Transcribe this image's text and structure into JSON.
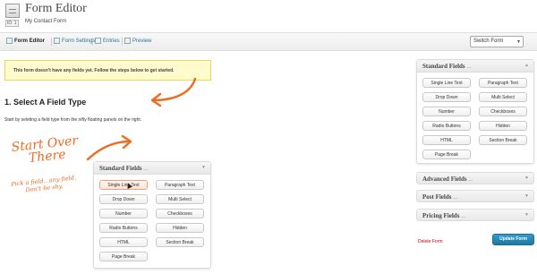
{
  "header": {
    "title": "Form Editor",
    "id_badge": "ID: 1",
    "form_name": "My Contact Form"
  },
  "toolbar": {
    "form_editor": "Form Editor",
    "form_settings": "Form Settings",
    "entries": "Entries",
    "preview": "Preview",
    "switch_form": "Switch Form"
  },
  "notice": "This form doesn't have any fields yet. Follow the steps below to get started.",
  "step": {
    "title": "1. Select A Field Type",
    "description": "Start by seleting a field type from the nifty floating panels on the right."
  },
  "annotation": {
    "start_over": "Start Over",
    "there": "There",
    "pick_line1": "Pick a field.. any field.",
    "pick_line2": "Don't be shy."
  },
  "floating_panel": {
    "title": "Standard Fields",
    "dots": "...",
    "toggle": "▼",
    "buttons": [
      "Single Line Text",
      "Paragraph Text",
      "Drop Down",
      "Multi Select",
      "Number",
      "Checkboxes",
      "Radio Buttons",
      "Hidden",
      "HTML",
      "Section Break",
      "Page Break"
    ],
    "hovered": "Single Line Text"
  },
  "sidebar": {
    "standard": {
      "title": "Standard Fields",
      "dots": "...",
      "toggle": "▲",
      "buttons": [
        "Single Line Text",
        "Paragraph Text",
        "Drop Down",
        "Multi Select",
        "Number",
        "Checkboxes",
        "Radio Buttons",
        "Hidden",
        "HTML",
        "Section Break",
        "Page Break"
      ]
    },
    "advanced": {
      "title": "Advanced Fields",
      "dots": "...",
      "toggle": "▼"
    },
    "post": {
      "title": "Post Fields",
      "dots": "...",
      "toggle": "▼"
    },
    "pricing": {
      "title": "Pricing Fields",
      "dots": "...",
      "toggle": "▼"
    }
  },
  "actions": {
    "delete": "Delete Form",
    "update": "Update Form"
  },
  "colors": {
    "accent_orange": "#ef6b1f",
    "link_blue": "#21759b",
    "delete_red": "#cc0000",
    "notice_bg": "#fffbcc"
  }
}
